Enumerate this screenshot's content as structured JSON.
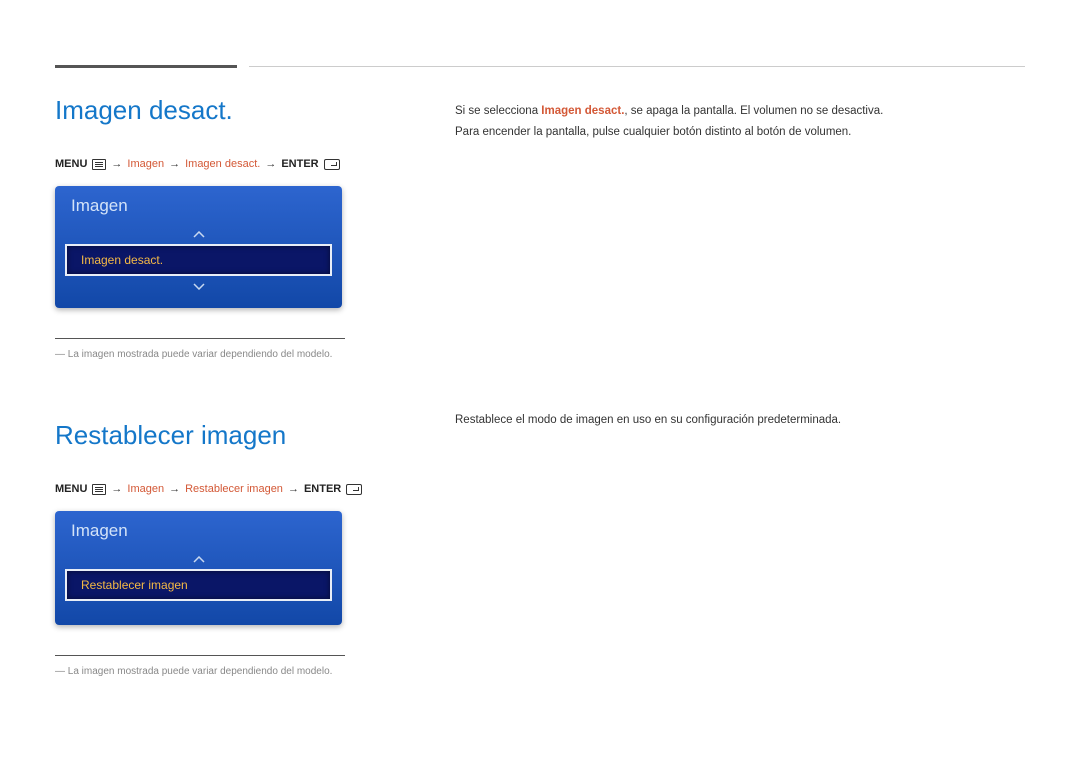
{
  "section1": {
    "heading": "Imagen desact.",
    "path": {
      "menu": "MENU",
      "p1": "Imagen",
      "p2": "Imagen desact.",
      "enter": "ENTER"
    },
    "menu_box": {
      "title": "Imagen",
      "selected": "Imagen desact."
    },
    "note": "La imagen mostrada puede variar dependiendo del modelo.",
    "body": {
      "line1_pre": "Si se selecciona ",
      "line1_hl": "Imagen desact.",
      "line1_post": ", se apaga la pantalla. El volumen no se desactiva.",
      "line2": "Para encender la pantalla, pulse cualquier botón distinto al botón de volumen."
    }
  },
  "section2": {
    "heading": "Restablecer imagen",
    "path": {
      "menu": "MENU",
      "p1": "Imagen",
      "p2": "Restablecer imagen",
      "enter": "ENTER"
    },
    "menu_box": {
      "title": "Imagen",
      "selected": "Restablecer imagen"
    },
    "note": "La imagen mostrada puede variar dependiendo del modelo.",
    "body": "Restablece el modo de imagen en uso en su configuración predeterminada."
  }
}
